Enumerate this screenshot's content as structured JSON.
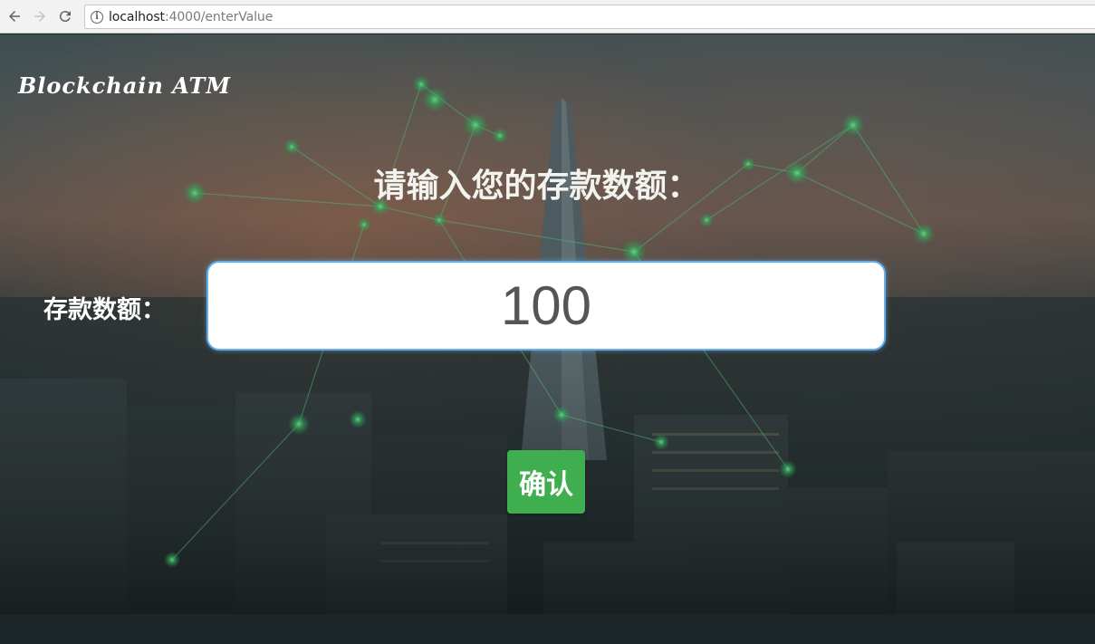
{
  "browser": {
    "url_host": "localhost",
    "url_path": ":4000/enterValue",
    "icons": {
      "back": "arrow-left-icon",
      "forward": "arrow-right-icon",
      "reload": "reload-icon",
      "site_info": "info-icon"
    }
  },
  "page": {
    "logo": "Blockchain ATM",
    "title": "请输入您的存款数额：",
    "amount_label": "存款数额：",
    "amount_value": "100",
    "confirm_label": "确认"
  },
  "colors": {
    "confirm_button": "#3fae4f",
    "input_focus_border": "#66afe9",
    "network_glow": "#4ddb7a"
  }
}
